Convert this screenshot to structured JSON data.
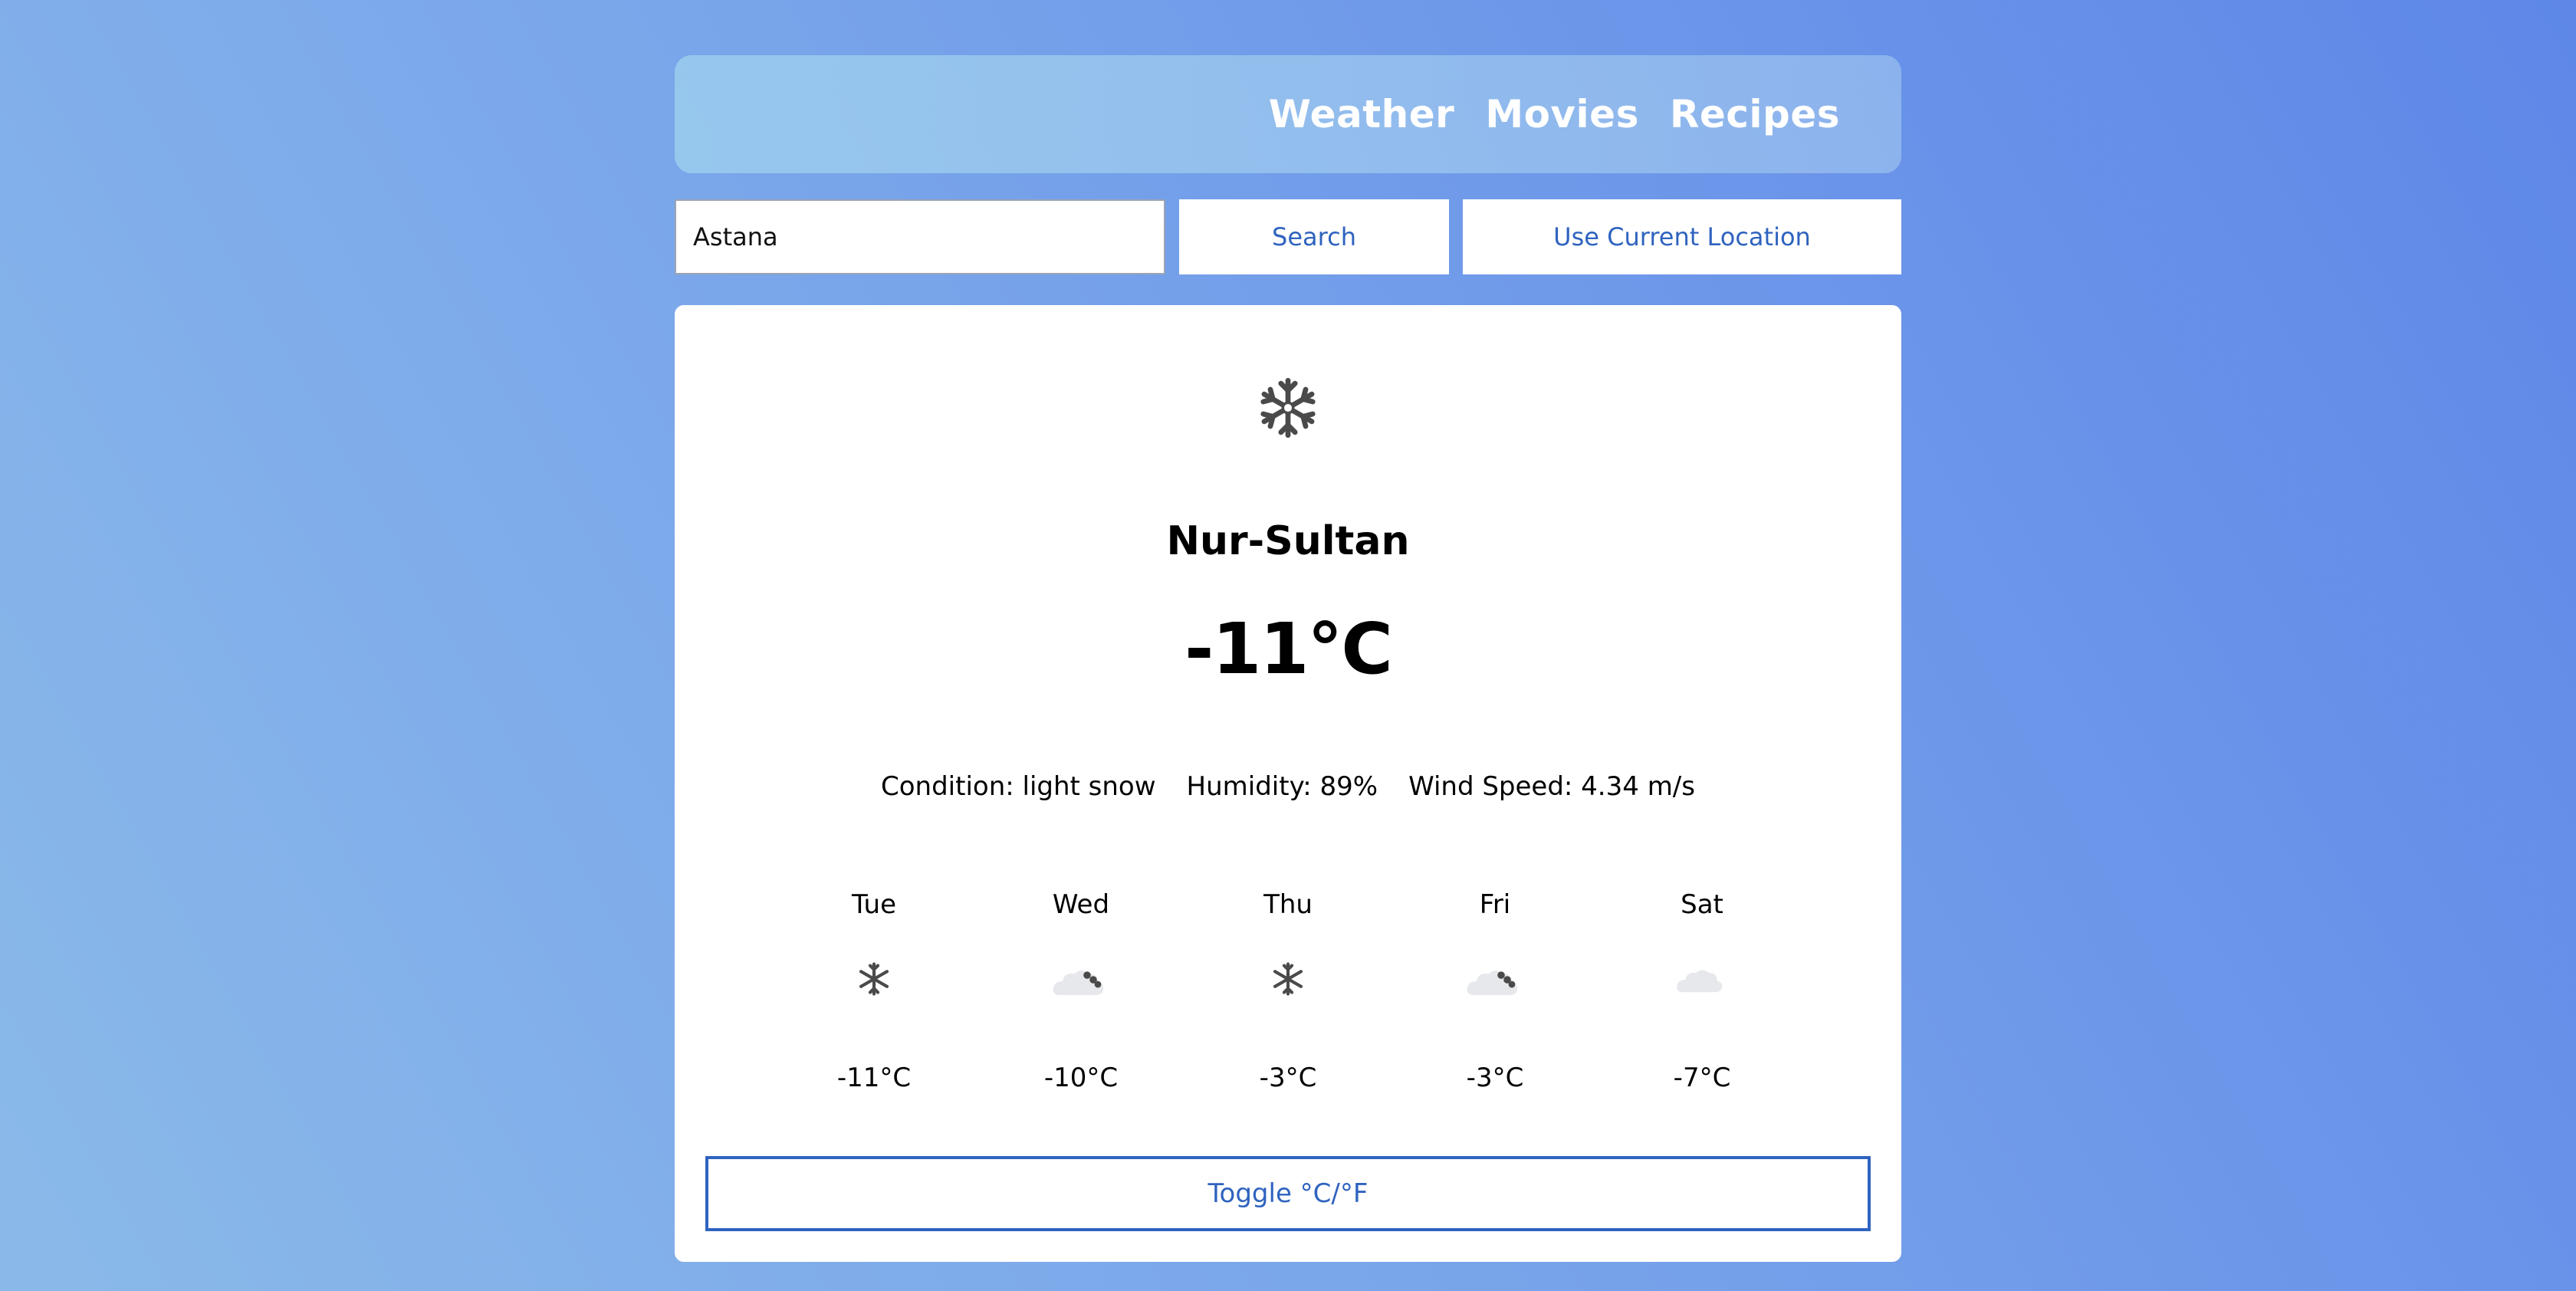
{
  "nav": {
    "items": [
      "Weather",
      "Movies",
      "Recipes"
    ]
  },
  "search": {
    "value": "Astana",
    "search_label": "Search",
    "location_label": "Use Current Location"
  },
  "current": {
    "icon": "snowflake-icon",
    "city": "Nur-Sultan",
    "temperature": "-11°C",
    "condition": "Condition: light snow",
    "humidity": "Humidity: 89%",
    "wind": "Wind Speed: 4.34 m/s"
  },
  "forecast": [
    {
      "day": "Tue",
      "icon": "snowflake-icon",
      "temp": "-11°C"
    },
    {
      "day": "Wed",
      "icon": "cloud-snow-icon",
      "temp": "-10°C"
    },
    {
      "day": "Thu",
      "icon": "snowflake-icon",
      "temp": "-3°C"
    },
    {
      "day": "Fri",
      "icon": "cloud-snow-icon",
      "temp": "-3°C"
    },
    {
      "day": "Sat",
      "icon": "cloud-icon",
      "temp": "-7°C"
    }
  ],
  "toggle": {
    "label": "Toggle °C/°F"
  },
  "colors": {
    "accent": "#2f63bf",
    "icon_dark": "#4a4a4a",
    "icon_light": "#e6e8eb"
  }
}
